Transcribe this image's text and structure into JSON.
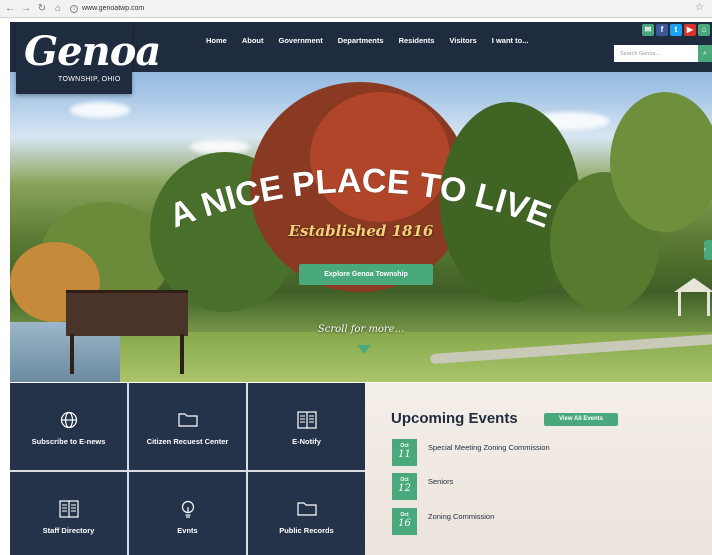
{
  "browser": {
    "url": "www.genoatwp.com"
  },
  "site": {
    "logo": "Genoa",
    "logo_sub": "TOWNSHIP, OHIO"
  },
  "nav": [
    "Home",
    "About",
    "Government",
    "Departments",
    "Residents",
    "Visitors",
    "I want to..."
  ],
  "search": {
    "placeholder": "Search Genoa..."
  },
  "hero": {
    "title": "A NICE PLACE TO LIVE",
    "subtitle": "Established 1816",
    "button": "Explore Genoa Township",
    "scroll": "Scroll for more..."
  },
  "tiles": [
    {
      "label": "Subscribe to E-news",
      "icon": "globe-icon"
    },
    {
      "label": "Citizen Recuest Center",
      "icon": "folder-icon"
    },
    {
      "label": "E-Notify",
      "icon": "book-icon"
    },
    {
      "label": "Staff Directory",
      "icon": "book-icon"
    },
    {
      "label": "Evnts",
      "icon": "lightbulb-icon"
    },
    {
      "label": "Public Records",
      "icon": "folder-icon"
    }
  ],
  "events": {
    "title": "Upcoming Events",
    "view_all": "View All Events",
    "items": [
      {
        "month": "Oct",
        "day": "11",
        "name": "Special Meeting Zoning Commission"
      },
      {
        "month": "Oct",
        "day": "12",
        "name": "Seniors"
      },
      {
        "month": "Oct",
        "day": "16",
        "name": "Zoning Commission"
      }
    ]
  },
  "colors": {
    "navy": "#1f2b3e",
    "tile": "#24324a",
    "accent": "#4aa97c",
    "gold": "#f3d27a"
  }
}
